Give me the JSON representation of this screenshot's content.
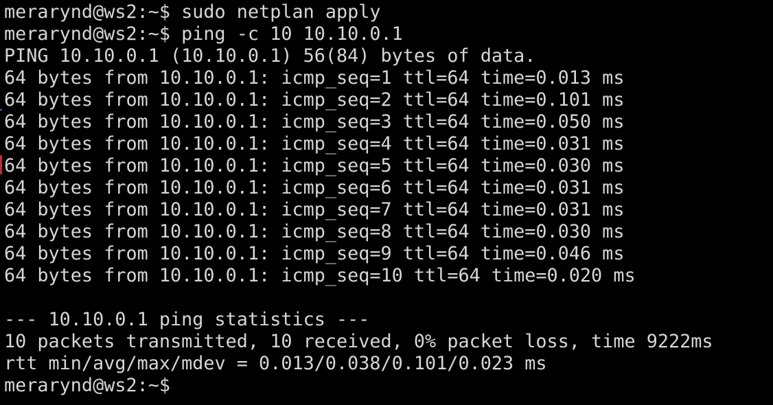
{
  "terminal": {
    "lines": [
      "merarynd@ws2:~$ sudo netplan apply",
      "merarynd@ws2:~$ ping -c 10 10.10.0.1",
      "PING 10.10.0.1 (10.10.0.1) 56(84) bytes of data.",
      "64 bytes from 10.10.0.1: icmp_seq=1 ttl=64 time=0.013 ms",
      "64 bytes from 10.10.0.1: icmp_seq=2 ttl=64 time=0.101 ms",
      "64 bytes from 10.10.0.1: icmp_seq=3 ttl=64 time=0.050 ms",
      "64 bytes from 10.10.0.1: icmp_seq=4 ttl=64 time=0.031 ms",
      "64 bytes from 10.10.0.1: icmp_seq=5 ttl=64 time=0.030 ms",
      "64 bytes from 10.10.0.1: icmp_seq=6 ttl=64 time=0.031 ms",
      "64 bytes from 10.10.0.1: icmp_seq=7 ttl=64 time=0.031 ms",
      "64 bytes from 10.10.0.1: icmp_seq=8 ttl=64 time=0.030 ms",
      "64 bytes from 10.10.0.1: icmp_seq=9 ttl=64 time=0.046 ms",
      "64 bytes from 10.10.0.1: icmp_seq=10 ttl=64 time=0.020 ms",
      "",
      "--- 10.10.0.1 ping statistics ---",
      "10 packets transmitted, 10 received, 0% packet loss, time 9222ms",
      "rtt min/avg/max/mdev = 0.013/0.038/0.101/0.023 ms",
      "merarynd@ws2:~$"
    ]
  },
  "colors": {
    "background": "#000000",
    "foreground": "#d6d6d6"
  }
}
